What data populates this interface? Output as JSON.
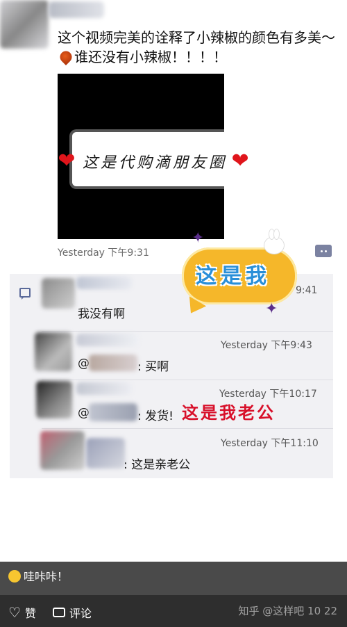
{
  "post": {
    "text_part1": "这个视频完美的诠释了小辣椒的颜色有多美～",
    "text_part2": "谁还没有小辣椒！！！！",
    "video_banner": "这是代购滴朋友圈",
    "timestamp": "Yesterday 下午9:31"
  },
  "sticker": {
    "text": "这是我"
  },
  "comments": [
    {
      "time": "9:41",
      "text": "我没有啊"
    },
    {
      "time": "Yesterday 下午9:43",
      "text_prefix": "@",
      "text": ": 买啊"
    },
    {
      "time": "Yesterday 下午10:17",
      "text_prefix": "@",
      "text": ": 发货!"
    },
    {
      "time": "Yesterday 下午11:10",
      "text": ": 这是亲老公"
    }
  ],
  "annotation_red": "这是我老公",
  "bottom": {
    "status_text": "哇咔咔！",
    "like_label": "赞",
    "comment_label": "评论",
    "right_text": "知乎 @这样吧",
    "right_count_1": "10",
    "right_count_2": "22"
  },
  "colors": {
    "sticker_fill": "#f5b72a",
    "sticker_text": "#2a8fd8",
    "annotation_red": "#d8102a",
    "comments_bg": "#f1f1f4"
  }
}
